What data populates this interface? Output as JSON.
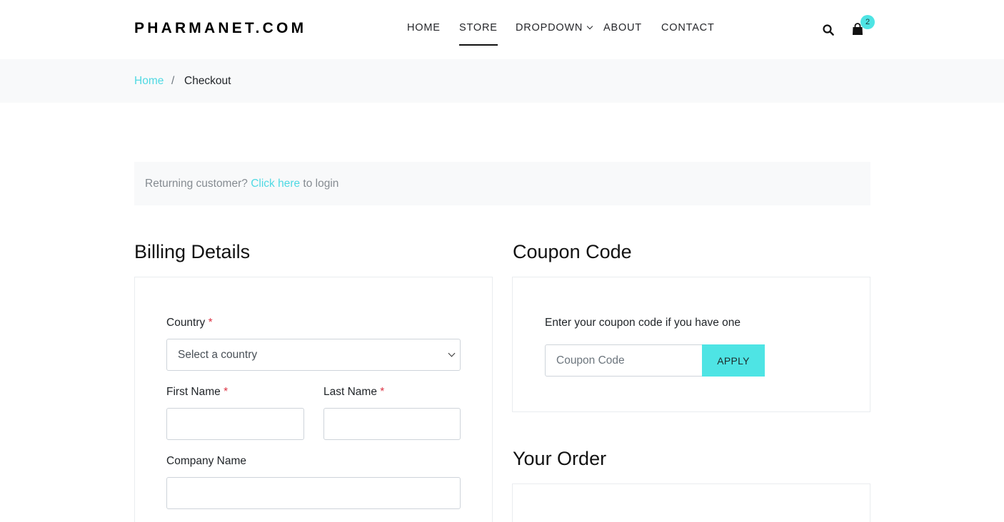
{
  "header": {
    "logo": "PHARMANET.COM",
    "nav": [
      {
        "label": "HOME",
        "active": false
      },
      {
        "label": "STORE",
        "active": true
      },
      {
        "label": "DROPDOWN",
        "active": false,
        "has_dropdown": true
      },
      {
        "label": "ABOUT",
        "active": false
      },
      {
        "label": "CONTACT",
        "active": false
      }
    ],
    "icons": {
      "search": "search-icon",
      "cart": "shopping-bag-icon"
    },
    "cart_count": "2"
  },
  "breadcrumb": {
    "home": "Home",
    "separator": "/",
    "current": "Checkout"
  },
  "returning": {
    "prefix": "Returning customer?",
    "link": "Click here",
    "suffix": "to login"
  },
  "billing": {
    "title": "Billing Details",
    "country_label": "Country",
    "country_placeholder": "Select a country",
    "first_name_label": "First Name",
    "last_name_label": "Last Name",
    "company_label": "Company Name",
    "required_mark": "*"
  },
  "coupon": {
    "title": "Coupon Code",
    "hint": "Enter your coupon code if you have one",
    "placeholder": "Coupon Code",
    "apply_label": "APPLY"
  },
  "order": {
    "title": "Your Order"
  },
  "colors": {
    "accent": "#4ee4e4",
    "link": "#4fd9e3",
    "required": "#dc3545",
    "light_bg": "#f8f9fa"
  }
}
